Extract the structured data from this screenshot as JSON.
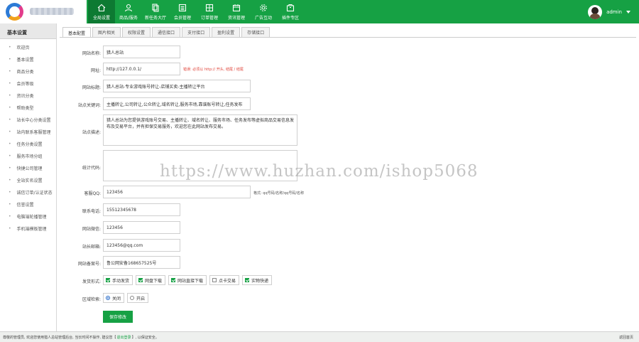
{
  "header": {
    "logo_icon": "app-logo-c-icon",
    "nav": [
      {
        "label": "全局设置",
        "icon": "home-icon",
        "active": true
      },
      {
        "label": "商品/服务",
        "icon": "user-icon"
      },
      {
        "label": "新任务大厅",
        "icon": "copy-icon"
      },
      {
        "label": "会员管理",
        "icon": "list-icon"
      },
      {
        "label": "订单管理",
        "icon": "grid-icon"
      },
      {
        "label": "资讯管理",
        "icon": "calendar-icon"
      },
      {
        "label": "广告互动",
        "icon": "gear-icon"
      },
      {
        "label": "插件专区",
        "icon": "package-icon"
      }
    ],
    "user": {
      "name": "admin"
    }
  },
  "sidebar": {
    "title": "基本设置",
    "items": [
      {
        "label": "欢迎页"
      },
      {
        "label": "基本设置"
      },
      {
        "label": "商品分类"
      },
      {
        "label": "会员等级"
      },
      {
        "label": "资讯分类"
      },
      {
        "label": "帮助类型"
      },
      {
        "label": "站长中心分类设置"
      },
      {
        "label": "站内联系客服管理"
      },
      {
        "label": "任务分类设置"
      },
      {
        "label": "服务市场分组"
      },
      {
        "label": "快捷公司管理"
      },
      {
        "label": "全站实名设置"
      },
      {
        "label": "诚信订单/认证状态"
      },
      {
        "label": "信誉设置"
      },
      {
        "label": "电脑端轮播管理"
      },
      {
        "label": "手机端模板管理"
      }
    ]
  },
  "tabs": [
    {
      "label": "基本配置",
      "active": true
    },
    {
      "label": "图片相关"
    },
    {
      "label": "权限设置"
    },
    {
      "label": "通信接口"
    },
    {
      "label": "支付接口"
    },
    {
      "label": "盈利设置"
    },
    {
      "label": "存储接口"
    }
  ],
  "form": {
    "site_name": {
      "label": "网站名称:",
      "value": "猎人总站"
    },
    "site_url": {
      "label": "网址:",
      "value": "http://127.0.0.1/",
      "hint": "错误: 必须以 http:// 开头, 结尾 / 结尾"
    },
    "site_title": {
      "label": "网站标题:",
      "value": "猎人总站-专业游戏账号转让-店铺买卖-主播转让平台"
    },
    "keywords": {
      "label": "站点关键词:",
      "value": "主播转让,公司转让,公众转让,域名转让,服务市场,靠谱账号转让,任务发布"
    },
    "description": {
      "label": "站点描述:",
      "value": "猎人总站为您提供游戏账号交易、主播转让、域名转让、服务市场、任务发布等虚拟商品交易信息发布及交易平台，并有担保交易服务，欢迎您在此网站发布交易。"
    },
    "stats_code": {
      "label": "统计代码:",
      "value": ""
    },
    "qq": {
      "label": "客服QQ:",
      "value": "123456",
      "hint": "格式: qq号码/名称/qq号码/名称"
    },
    "phone": {
      "label": "联系电话:",
      "value": "15512345678"
    },
    "wechat": {
      "label": "网站微信:",
      "value": "123456"
    },
    "email": {
      "label": "站长邮箱:",
      "value": "123456@qq.com"
    },
    "icp": {
      "label": "网站备案号:",
      "value": "鲁公网安备168657525号"
    },
    "release_mode": {
      "label": "发货形式:",
      "options": [
        {
          "label": "手动发货",
          "checked": true
        },
        {
          "label": "网盘下载",
          "checked": true
        },
        {
          "label": "网站直接下载",
          "checked": true
        },
        {
          "label": "点卡交易",
          "checked": false
        },
        {
          "label": "实物快递",
          "checked": true
        }
      ]
    },
    "region": {
      "label": "区域检索:",
      "options": [
        {
          "label": "关闭",
          "selected": true
        },
        {
          "label": "开启",
          "selected": false
        }
      ]
    },
    "save_label": "保存修改"
  },
  "watermark": "https://www.huzhan.com/ishop5068",
  "footer": {
    "text_before": "尊敬的管理员, 欢迎您使用猎人总站管理后台, 当长时间不操作, 建议您【",
    "link": "退出登录",
    "text_after": "】, 以保证安全。",
    "back_top": "返回首页"
  },
  "colors": {
    "brand": "#16a144",
    "hint_red": "#e0443a"
  }
}
